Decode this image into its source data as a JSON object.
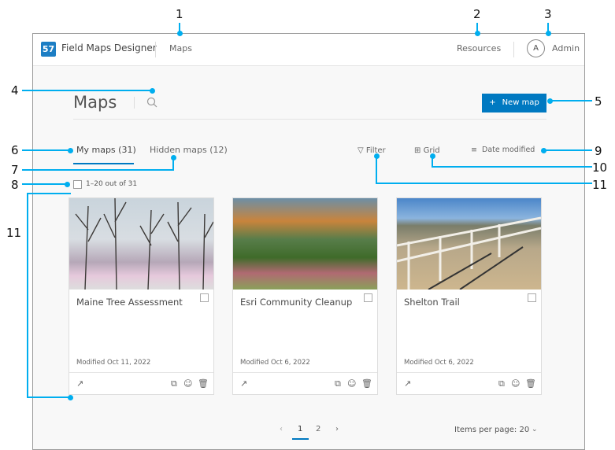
{
  "header": {
    "app_title": "Field Maps Designer",
    "nav_maps": "Maps",
    "resources": "Resources",
    "avatar_initial": "A",
    "user": "Admin"
  },
  "page": {
    "title": "Maps",
    "new_map": "New map",
    "new_map_icon": "plus-icon",
    "accent": "#0079c1"
  },
  "tabs": [
    {
      "label": "My maps (31)",
      "active": true
    },
    {
      "label": "Hidden maps (12)",
      "active": false
    }
  ],
  "toolbar": {
    "filter": "Filter",
    "grid": "Grid",
    "sort": "Date modified"
  },
  "selection": {
    "count_label": "1–20 out of 31"
  },
  "cards": [
    {
      "title": "Maine Tree Assessment",
      "modified": "Modified Oct 11, 2022"
    },
    {
      "title": "Esri Community Cleanup",
      "modified": "Modified Oct 6, 2022"
    },
    {
      "title": "Shelton Trail",
      "modified": "Modified Oct 6, 2022"
    }
  ],
  "pagination": {
    "pages": [
      "1",
      "2"
    ],
    "current": "1",
    "items_per_page": "Items per page: 20"
  },
  "callouts": [
    "1",
    "2",
    "3",
    "4",
    "5",
    "6",
    "7",
    "8",
    "9",
    "10",
    "11",
    "11"
  ],
  "callout_color": "#00aeef"
}
